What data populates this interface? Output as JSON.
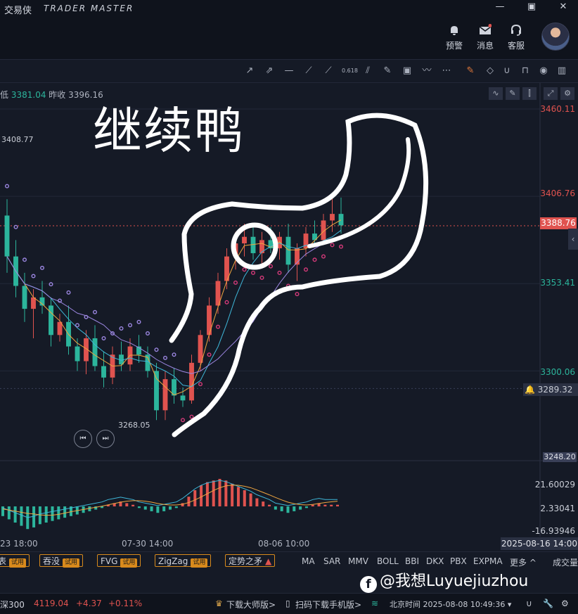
{
  "window": {
    "app_name": "交易侠",
    "app_sub": "TRADER MASTER",
    "min": "—",
    "restore": "▣",
    "close": "✕"
  },
  "header": {
    "alert_label": "预警",
    "message_label": "消息",
    "service_label": "客服"
  },
  "info": {
    "low_label": "低",
    "low_value": "3381.04",
    "prev_close_label": "昨收",
    "prev_close_value": "3396.16"
  },
  "annotation": {
    "handwritten_text": "继续鸭"
  },
  "price_axis": {
    "ticks": [
      {
        "label": "3460.11",
        "value": 3460.11,
        "color": "#e0534f"
      },
      {
        "label": "3406.76",
        "value": 3406.76,
        "color": "#e0534f"
      },
      {
        "label": "3353.41",
        "value": 3353.41,
        "color": "#2cb59c"
      },
      {
        "label": "3300.06",
        "value": 3300.06,
        "color": "#2cb59c"
      },
      {
        "label": "3248.20",
        "value": 3248.2,
        "color": "#c9cdd6"
      }
    ],
    "current_price": "3388.76",
    "alert_price": "3289.32"
  },
  "chart_labels": {
    "high_label": "3408.77",
    "low_label": "3268.05"
  },
  "macd_axis": {
    "ticks": [
      "21.60029",
      "2.33041",
      "-16.93946"
    ]
  },
  "time_axis": {
    "ticks": [
      "23 18:00",
      "07-30 14:00",
      "08-06 10:00"
    ],
    "current": "2025-08-16 14:00"
  },
  "indicator_buttons": [
    {
      "label": "表",
      "tag": "试用"
    },
    {
      "label": "吞没",
      "tag": "试用"
    },
    {
      "label": "FVG",
      "tag": "试用"
    },
    {
      "label": "ZigZag",
      "tag": "试用"
    },
    {
      "label": "定势之矛",
      "tag": ""
    }
  ],
  "indicator_items": [
    "MA",
    "SAR",
    "MMV",
    "BOLL",
    "BBI",
    "DKX",
    "PBX",
    "EXPMA",
    "更多 ^"
  ],
  "right_tab": "成交量",
  "status_bar": {
    "index_name": "深300",
    "index_value": "4119.04",
    "change": "+4.37",
    "change_pct": "+0.11%",
    "download_master": "下载大师版>",
    "scan_mobile": "扫码下载手机版>",
    "time_label": "北京时间 2025-08-08 10:49:36 ▾"
  },
  "watermark": {
    "text": "@我想Luyuejiuzhou",
    "logo": "f"
  },
  "colors": {
    "up": "#e0534f",
    "down": "#2cb59c",
    "bg": "#151a26",
    "sar_up": "#d63a7a",
    "sar_down": "#9b86e0"
  },
  "chart_data": {
    "type": "candlestick",
    "price_range": [
      3248.2,
      3460.11
    ],
    "candles": [
      [
        3395,
        3405,
        3360,
        3370
      ],
      [
        3370,
        3380,
        3345,
        3352
      ],
      [
        3352,
        3360,
        3330,
        3338
      ],
      [
        3338,
        3350,
        3320,
        3345
      ],
      [
        3345,
        3355,
        3335,
        3340
      ],
      [
        3340,
        3345,
        3315,
        3322
      ],
      [
        3322,
        3335,
        3318,
        3330
      ],
      [
        3330,
        3340,
        3310,
        3315
      ],
      [
        3315,
        3320,
        3300,
        3306
      ],
      [
        3306,
        3325,
        3298,
        3320
      ],
      [
        3320,
        3328,
        3300,
        3303
      ],
      [
        3303,
        3312,
        3290,
        3296
      ],
      [
        3296,
        3315,
        3292,
        3310
      ],
      [
        3310,
        3318,
        3300,
        3304
      ],
      [
        3304,
        3320,
        3300,
        3315
      ],
      [
        3315,
        3322,
        3305,
        3310
      ],
      [
        3310,
        3315,
        3296,
        3300
      ],
      [
        3300,
        3305,
        3270,
        3276
      ],
      [
        3276,
        3300,
        3270,
        3295
      ],
      [
        3295,
        3302,
        3280,
        3285
      ],
      [
        3285,
        3290,
        3278,
        3282
      ],
      [
        3282,
        3310,
        3280,
        3305
      ],
      [
        3305,
        3325,
        3300,
        3322
      ],
      [
        3322,
        3345,
        3318,
        3340
      ],
      [
        3340,
        3360,
        3335,
        3355
      ],
      [
        3355,
        3375,
        3350,
        3370
      ],
      [
        3370,
        3385,
        3362,
        3378
      ],
      [
        3378,
        3390,
        3370,
        3382
      ],
      [
        3382,
        3388,
        3368,
        3372
      ],
      [
        3372,
        3385,
        3365,
        3380
      ],
      [
        3380,
        3388,
        3372,
        3375
      ],
      [
        3375,
        3385,
        3368,
        3382
      ],
      [
        3382,
        3390,
        3360,
        3365
      ],
      [
        3365,
        3378,
        3355,
        3375
      ],
      [
        3375,
        3388,
        3370,
        3384
      ],
      [
        3384,
        3392,
        3376,
        3380
      ],
      [
        3380,
        3396,
        3378,
        3392
      ],
      [
        3392,
        3408,
        3385,
        3396
      ],
      [
        3396,
        3406,
        3384,
        3389
      ]
    ],
    "macd_hist": [
      -6,
      -8,
      -10,
      -12,
      -14,
      -13,
      -11,
      -10,
      -9,
      -8,
      -7,
      -6,
      -5,
      -4,
      -3,
      -2,
      -1,
      1,
      2,
      3,
      2,
      1,
      -1,
      -2,
      -3,
      -4,
      -3,
      -2,
      -1,
      2,
      6,
      10,
      13,
      15,
      16,
      17,
      16,
      14,
      12,
      10,
      8,
      5,
      3,
      1,
      -2,
      -3,
      -4,
      -3,
      -2,
      -1,
      1,
      2,
      1,
      1,
      1
    ]
  }
}
